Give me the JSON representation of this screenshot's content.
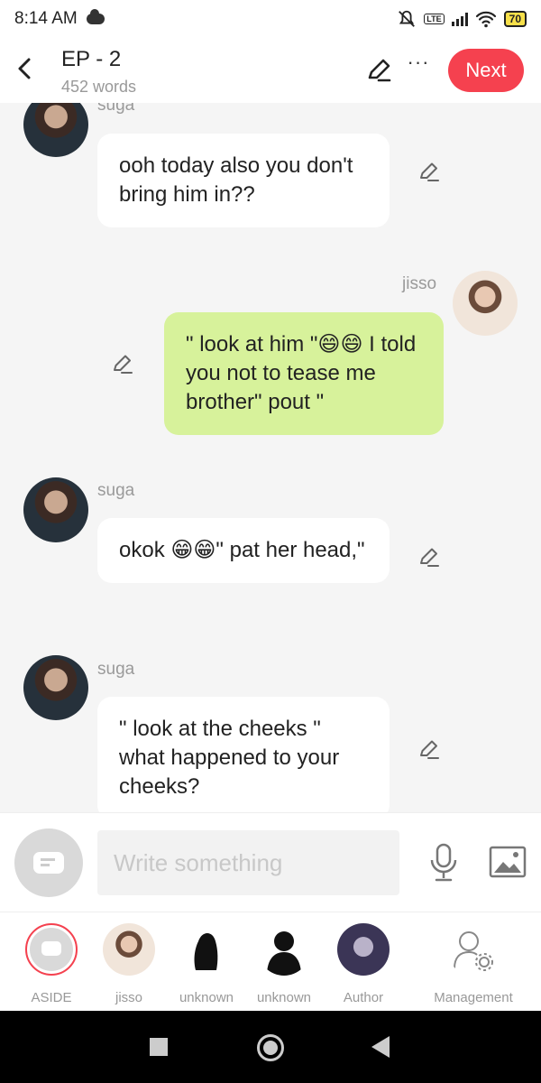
{
  "status_bar": {
    "time": "8:14 AM",
    "network": "LTE",
    "battery": "70"
  },
  "header": {
    "title": "EP - 2",
    "word_count": "452 words",
    "next_label": "Next",
    "more_label": "···"
  },
  "messages": [
    {
      "name": "suga",
      "text": "ooh today also you don't bring him in??"
    },
    {
      "name": "jisso",
      "text": "\" look at him \"😄😄 I told you not to tease me brother\" pout \""
    },
    {
      "name": "suga",
      "text": "okok 😁😁\" pat her head,\""
    },
    {
      "name": "suga",
      "text": "\" look at the cheeks \" what happened to your cheeks?"
    }
  ],
  "input": {
    "placeholder": "Write something"
  },
  "characters": [
    {
      "label": "ASIDE"
    },
    {
      "label": "jisso"
    },
    {
      "label": "unknown"
    },
    {
      "label": "unknown"
    },
    {
      "label": "Author"
    },
    {
      "label": "Management"
    }
  ],
  "colors": {
    "accent": "#f5414f",
    "green_bubble": "#d7f29b",
    "background": "#f5f5f5"
  }
}
